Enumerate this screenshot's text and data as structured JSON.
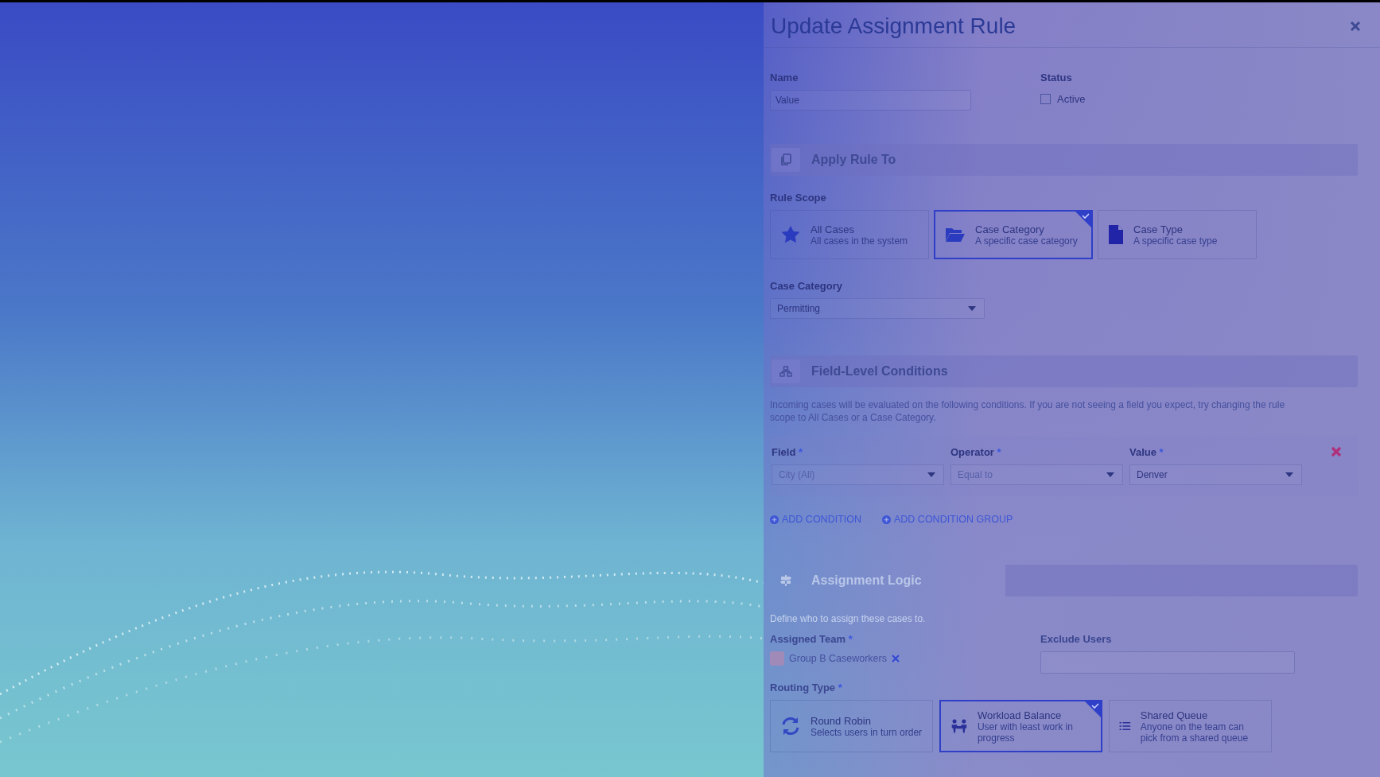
{
  "dialog": {
    "title": "Update Assignment Rule"
  },
  "name_field": {
    "label": "Name",
    "placeholder": "Value"
  },
  "status": {
    "label": "Status",
    "checkbox": {
      "label": "Active",
      "checked": false
    }
  },
  "apply_rule_to": {
    "heading": "Apply Rule To",
    "rule_scope": {
      "label": "Rule Scope",
      "options": [
        {
          "kind": "star",
          "title": "All Cases",
          "description": "All cases in the system",
          "selected": false
        },
        {
          "kind": "folder",
          "title": "Case Category",
          "description": "A specific case category",
          "selected": true
        },
        {
          "kind": "document",
          "title": "Case Type",
          "description": "A specific case type",
          "selected": false
        }
      ]
    },
    "case_category": {
      "label": "Case Category",
      "value": "Permitting"
    }
  },
  "field_level_conditions": {
    "heading": "Field-Level Conditions",
    "description": "Incoming cases will be evaluated on the following conditions. If you are not seeing a field you expect, try changing the rule scope to All Cases or a Case Category.",
    "conditions": [
      {
        "fields": [
          {
            "label": "Field",
            "mark": "*",
            "value": "City (All)",
            "disabled": true
          },
          {
            "label": "Operator",
            "mark": "*",
            "value": "Equal to",
            "disabled": true
          },
          {
            "label": "Value",
            "mark": "*",
            "value": "Denver",
            "disabled": false
          }
        ]
      }
    ],
    "actions": [
      "ADD CONDITION",
      "ADD CONDITION GROUP"
    ]
  },
  "assignment_logic": {
    "heading": "Assignment Logic",
    "description": "Define who to assign these cases to.",
    "assigned_team": {
      "label": "Assigned Team",
      "mark": "*",
      "chips": [
        {
          "label": "Group B Caseworkers"
        }
      ]
    },
    "exclude_users": {
      "label": "Exclude Users"
    },
    "routing_type": {
      "label": "Routing Type",
      "mark": "*",
      "options": [
        {
          "kind": "cycle",
          "title": "Round Robin",
          "description": "Selects users in turn order",
          "selected": false
        },
        {
          "kind": "people",
          "title": "Workload Balance",
          "description": "User with least work in progress",
          "selected": true
        },
        {
          "kind": "list",
          "title": "Shared Queue",
          "description": "Anyone on the team can pick from a shared queue",
          "selected": false
        }
      ]
    }
  }
}
